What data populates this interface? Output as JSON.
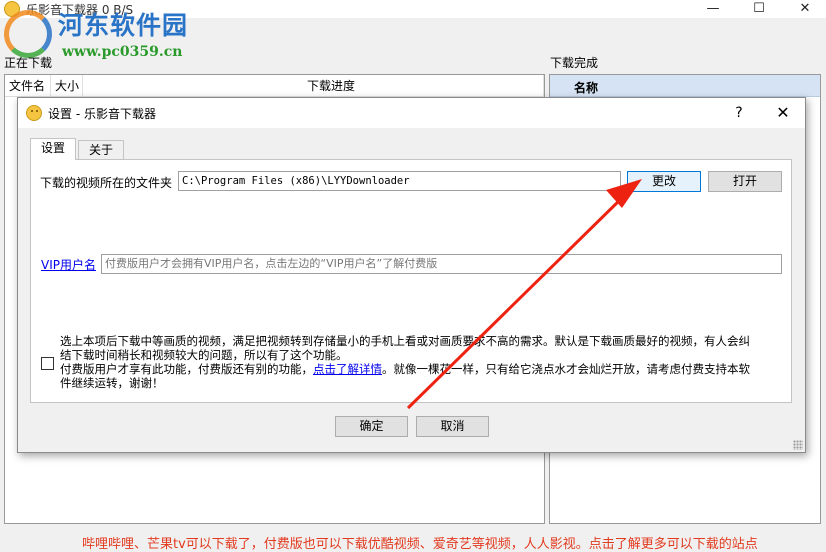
{
  "main": {
    "title": "乐影音下载器   0 B/S",
    "controls": {
      "minimize": "—",
      "maximize": "☐",
      "close": "✕"
    },
    "downloading_label": "正在下载",
    "completed_label": "下载完成",
    "columns": {
      "filename": "文件名",
      "size": "大小",
      "progress": "下载进度",
      "name": "名称"
    },
    "bottom_ad": "哔哩哔哩、芒果tv可以下载了，付费版也可以下载优酷视频、爱奇艺等视频，人人影视。点击了解更多可以下载的站点"
  },
  "watermark": {
    "logo": "河东软件园",
    "url": "www.pc0359.cn"
  },
  "dialog": {
    "title": "设置 - 乐影音下载器",
    "help": "?",
    "close": "✕",
    "tabs": {
      "settings": "设置",
      "about": "关于"
    },
    "folder_label": "下载的视频所在的文件夹",
    "folder_path": "C:\\Program Files (x86)\\LYYDownloader",
    "change_button": "更改",
    "open_button": "打开",
    "vip_link": "VIP用户名",
    "vip_placeholder": "付费版用户才会拥有VIP用户名，点击左边的“VIP用户名”了解付费版",
    "hq": {
      "line1": "选上本项后下载中等画质的视频，满足把视频转到存储量小的手机上看或对画质要求不高的需求。默认是下载画质最好的视频，有人会纠",
      "line2": "结下载时间稍长和视频较大的问题，所以有了这个功能。",
      "line3_pre": "付费版用户才享有此功能，付费版还有别的功能，",
      "line3_link": "点击了解详情",
      "line3_post": "。就像一棵花一样，只有给它浇点水才会灿烂开放，请考虑付费支持本软",
      "line4": "件继续运转，谢谢！",
      "checked": false
    },
    "ok_button": "确定",
    "cancel_button": "取消"
  },
  "colors": {
    "arrow": "#ee2211",
    "link": "#0000ee",
    "focus": "#0078d7"
  }
}
